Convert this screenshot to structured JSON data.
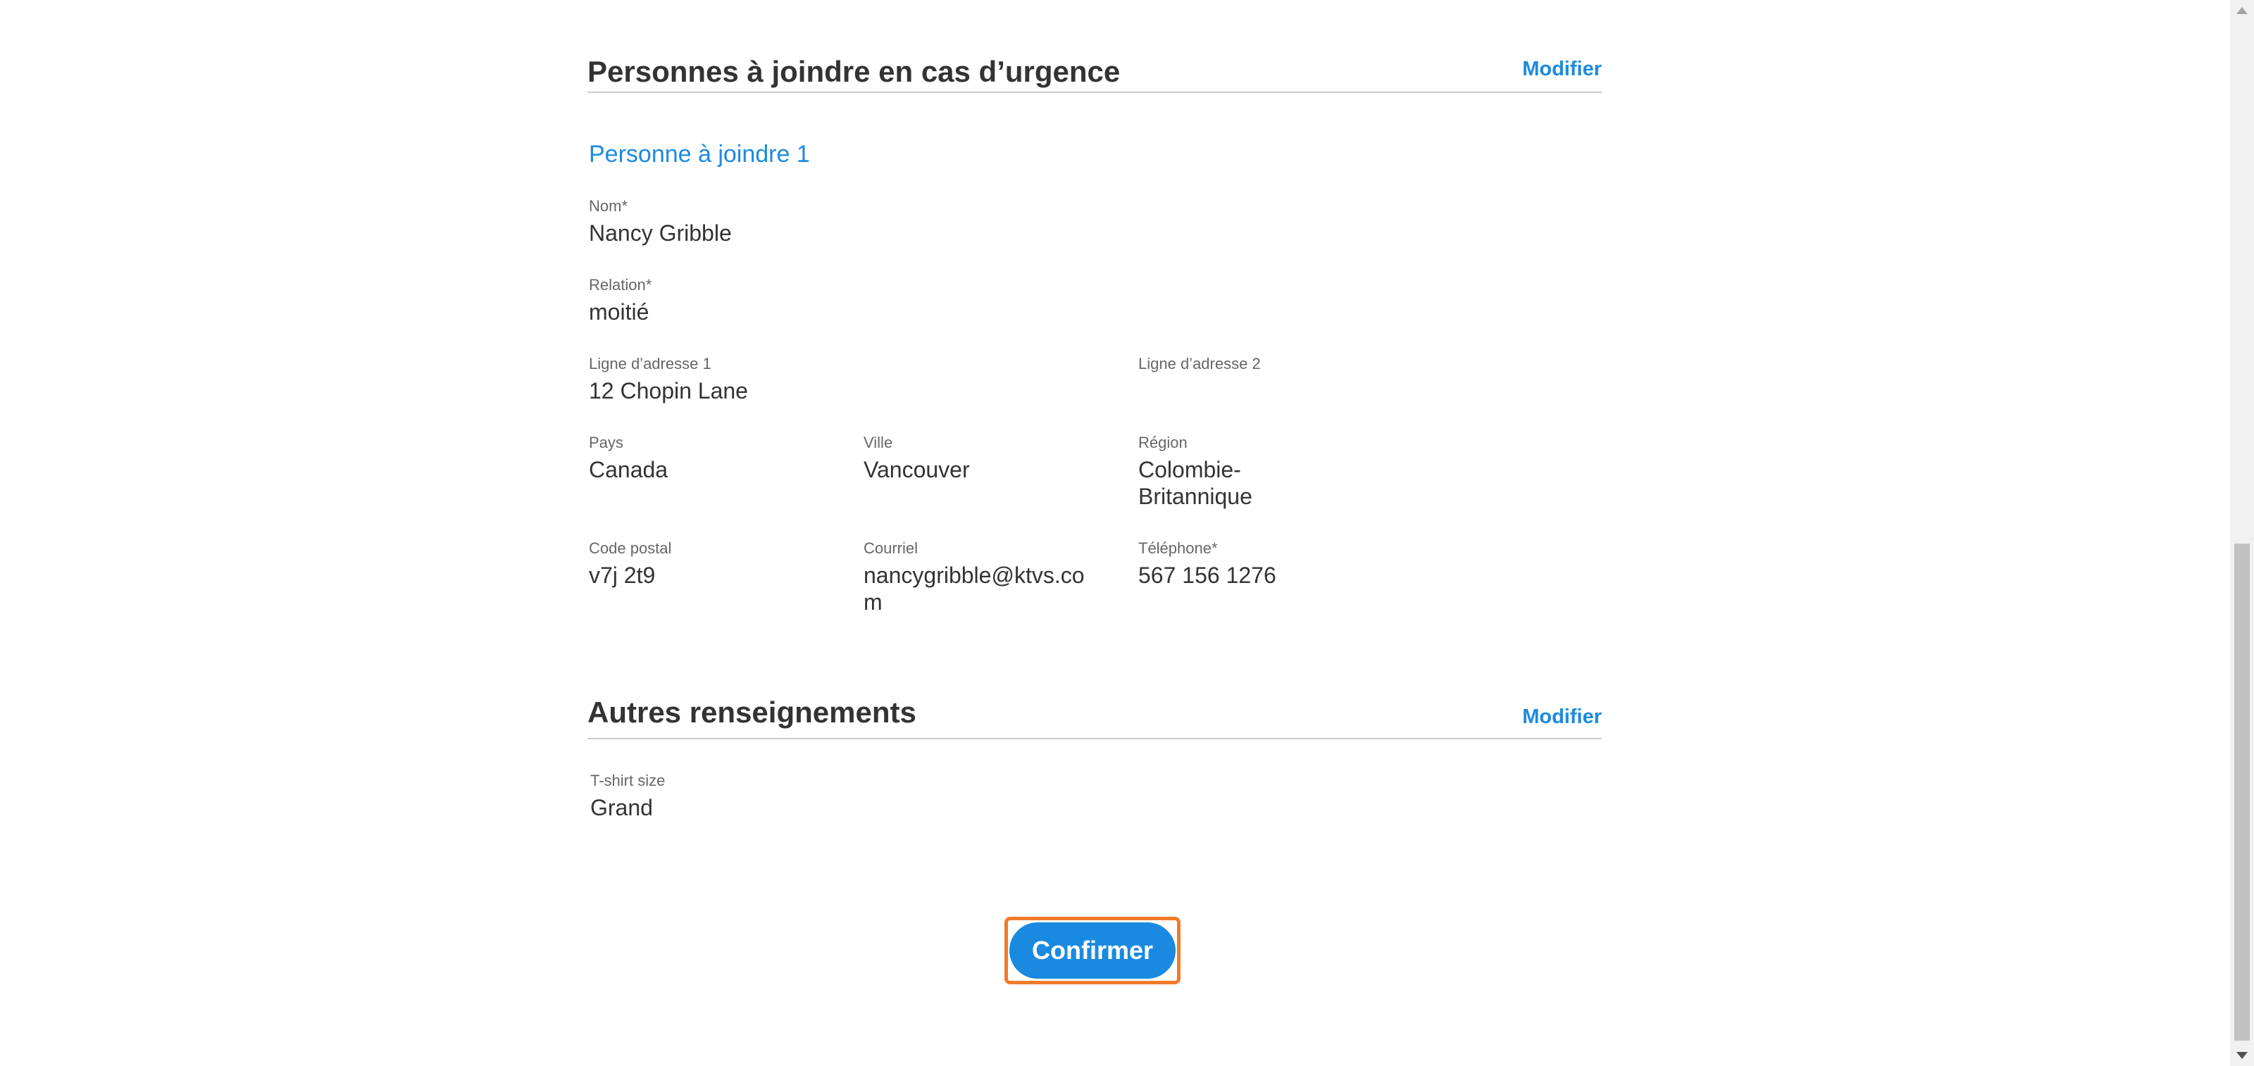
{
  "emergency": {
    "title": "Personnes à joindre en cas d’urgence",
    "modify_label": "Modifier",
    "contact_heading": "Personne à joindre 1",
    "fields": {
      "name": {
        "label": "Nom*",
        "value": "Nancy Gribble"
      },
      "relation": {
        "label": "Relation*",
        "value": "moitié"
      },
      "address1": {
        "label": "Ligne d’adresse 1",
        "value": "12 Chopin Lane"
      },
      "address2": {
        "label": "Ligne d’adresse 2",
        "value": ""
      },
      "country": {
        "label": "Pays",
        "value": "Canada"
      },
      "city": {
        "label": "Ville",
        "value": "Vancouver"
      },
      "region": {
        "label": "Région",
        "value": "Colombie-Britannique"
      },
      "postal": {
        "label": "Code postal",
        "value": "v7j 2t9"
      },
      "email": {
        "label": "Courriel",
        "value": "nancygribble@ktvs.com"
      },
      "phone": {
        "label": "Téléphone*",
        "value": "567 156 1276"
      }
    }
  },
  "other": {
    "title": "Autres renseignements",
    "modify_label": "Modifier",
    "fields": {
      "tshirt": {
        "label": "T-shirt size",
        "value": "Grand"
      }
    }
  },
  "actions": {
    "confirm_label": "Confirmer"
  },
  "colors": {
    "accent": "#1a8ae0",
    "highlight": "#f07b2a"
  }
}
